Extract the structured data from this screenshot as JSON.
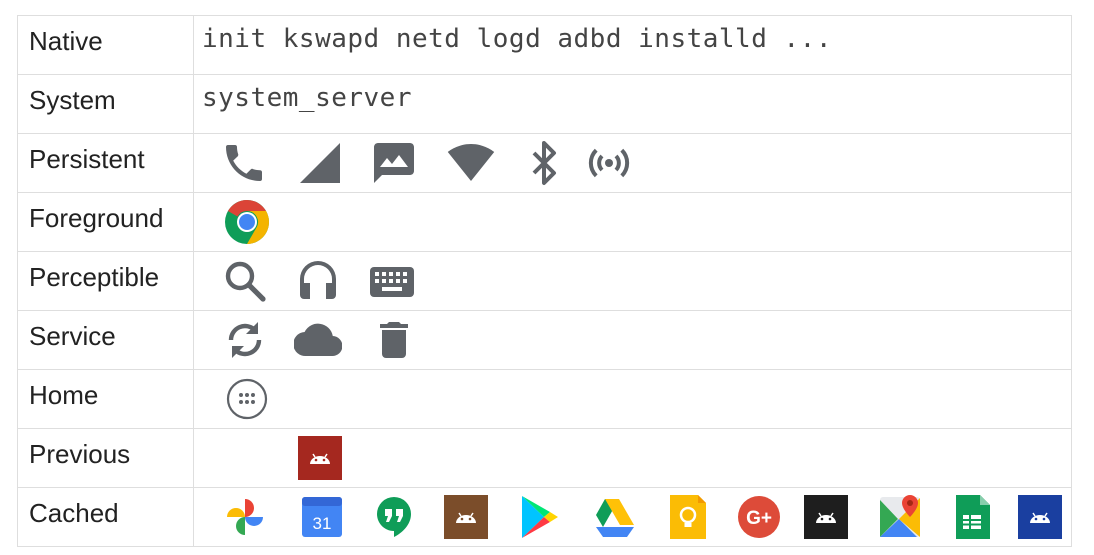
{
  "rows": [
    {
      "label": "Native",
      "text": "init kswapd netd logd adbd installd ..."
    },
    {
      "label": "System",
      "text": "system_server"
    },
    {
      "label": "Persistent",
      "icons": [
        "phone-icon",
        "cell-signal-icon",
        "mms-icon",
        "wifi-icon",
        "bluetooth-icon",
        "hotspot-icon"
      ]
    },
    {
      "label": "Foreground",
      "icons": [
        "chrome-icon"
      ]
    },
    {
      "label": "Perceptible",
      "icons": [
        "search-icon",
        "headphones-icon",
        "keyboard-icon"
      ]
    },
    {
      "label": "Service",
      "icons": [
        "sync-icon",
        "cloud-icon",
        "trash-icon"
      ]
    },
    {
      "label": "Home",
      "icons": [
        "app-drawer-icon"
      ]
    },
    {
      "label": "Previous",
      "icons": [
        "android-app-icon"
      ]
    },
    {
      "label": "Cached",
      "icons": [
        "photos-icon",
        "calendar-icon",
        "hangouts-icon",
        "android-app-icon",
        "play-store-icon",
        "drive-icon",
        "keep-icon",
        "google-plus-icon",
        "android-app-icon",
        "maps-icon",
        "sheets-icon",
        "android-app-icon"
      ]
    }
  ],
  "calendar_day": "31",
  "google_plus_text": "G+",
  "colors": {
    "icon_gray": "#5f6368",
    "border": "#dedede"
  }
}
